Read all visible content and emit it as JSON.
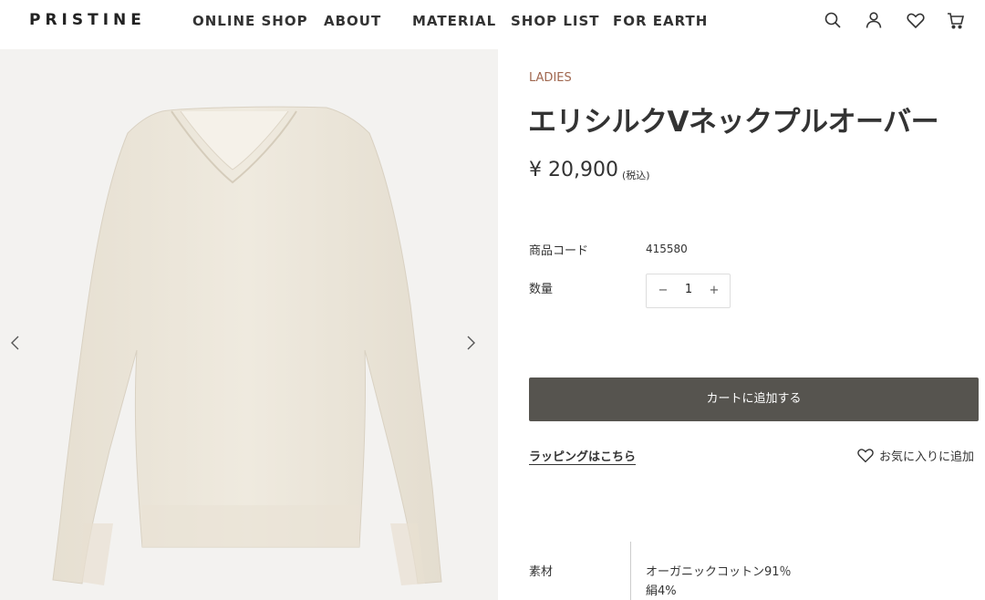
{
  "header": {
    "logo": "PRISTINE",
    "nav": [
      "ONLINE SHOP",
      "ABOUT",
      "MATERIAL",
      "SHOP LIST",
      "FOR EARTH"
    ],
    "icons": [
      "search-icon",
      "account-icon",
      "heart-icon",
      "cart-icon"
    ]
  },
  "gallery": {
    "prev_icon": "chevron-left-icon",
    "next_icon": "chevron-right-icon"
  },
  "product": {
    "category": "LADIES",
    "title": "エリシルクVネックプルオーバー",
    "price": "¥ 20,900",
    "tax_note": "(税込)",
    "code_label": "商品コード",
    "code_value": "415580",
    "qty_label": "数量",
    "qty_minus": "−",
    "qty_value": "1",
    "qty_plus": "+",
    "add_to_cart": "カートに追加する",
    "wrapping_link": "ラッピングはこちら",
    "favorite": "お気に入りに追加",
    "material_label": "素材",
    "materials": [
      "オーガニックコットン91％",
      "絹4%"
    ]
  },
  "colors": {
    "category": "#a0674f",
    "cart_button": "#56544f",
    "gallery_bg": "#f3f2f0",
    "garment": "#ece6da"
  }
}
